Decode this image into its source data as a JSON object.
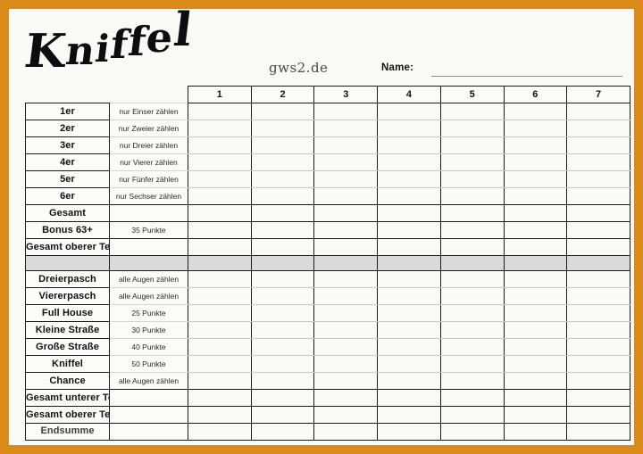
{
  "document": {
    "title": "Kniffel",
    "title_letters": [
      "K",
      "n",
      "i",
      "f",
      "f",
      "e",
      "l"
    ],
    "watermark": "gws2.de",
    "name_label": "Name:",
    "name_value": "",
    "frame_color": "#d98a18",
    "page_color": "#f9f9f5",
    "spacer_color": "#d9dbd8"
  },
  "table": {
    "column_headers": [
      "1",
      "2",
      "3",
      "4",
      "5",
      "6",
      "7"
    ],
    "upper_section": [
      {
        "label": "1er",
        "hint": "nur Einser zählen"
      },
      {
        "label": "2er",
        "hint": "nur Zweier zählen"
      },
      {
        "label": "3er",
        "hint": "nur Dreier zählen"
      },
      {
        "label": "4er",
        "hint": "nur Vierer zählen"
      },
      {
        "label": "5er",
        "hint": "nur Fünfer zählen"
      },
      {
        "label": "6er",
        "hint": "nur Sechser zählen"
      },
      {
        "label": "Gesamt",
        "hint": ""
      },
      {
        "label": "Bonus 63+",
        "hint": "35 Punkte"
      },
      {
        "label": "Gesamt oberer Teil",
        "hint": ""
      }
    ],
    "lower_section": [
      {
        "label": "Dreierpasch",
        "hint": "alle Augen zählen"
      },
      {
        "label": "Viererpasch",
        "hint": "alle Augen zählen"
      },
      {
        "label": "Full House",
        "hint": "25 Punkte"
      },
      {
        "label": "Kleine Straße",
        "hint": "30 Punkte"
      },
      {
        "label": "Große Straße",
        "hint": "40 Punkte"
      },
      {
        "label": "Kniffel",
        "hint": "50 Punkte"
      },
      {
        "label": "Chance",
        "hint": "alle Augen zählen"
      },
      {
        "label": "Gesamt unterer Teil",
        "hint": ""
      },
      {
        "label": "Gesamt oberer Teil",
        "hint": ""
      },
      {
        "label": "Endsumme",
        "hint": ""
      }
    ]
  }
}
